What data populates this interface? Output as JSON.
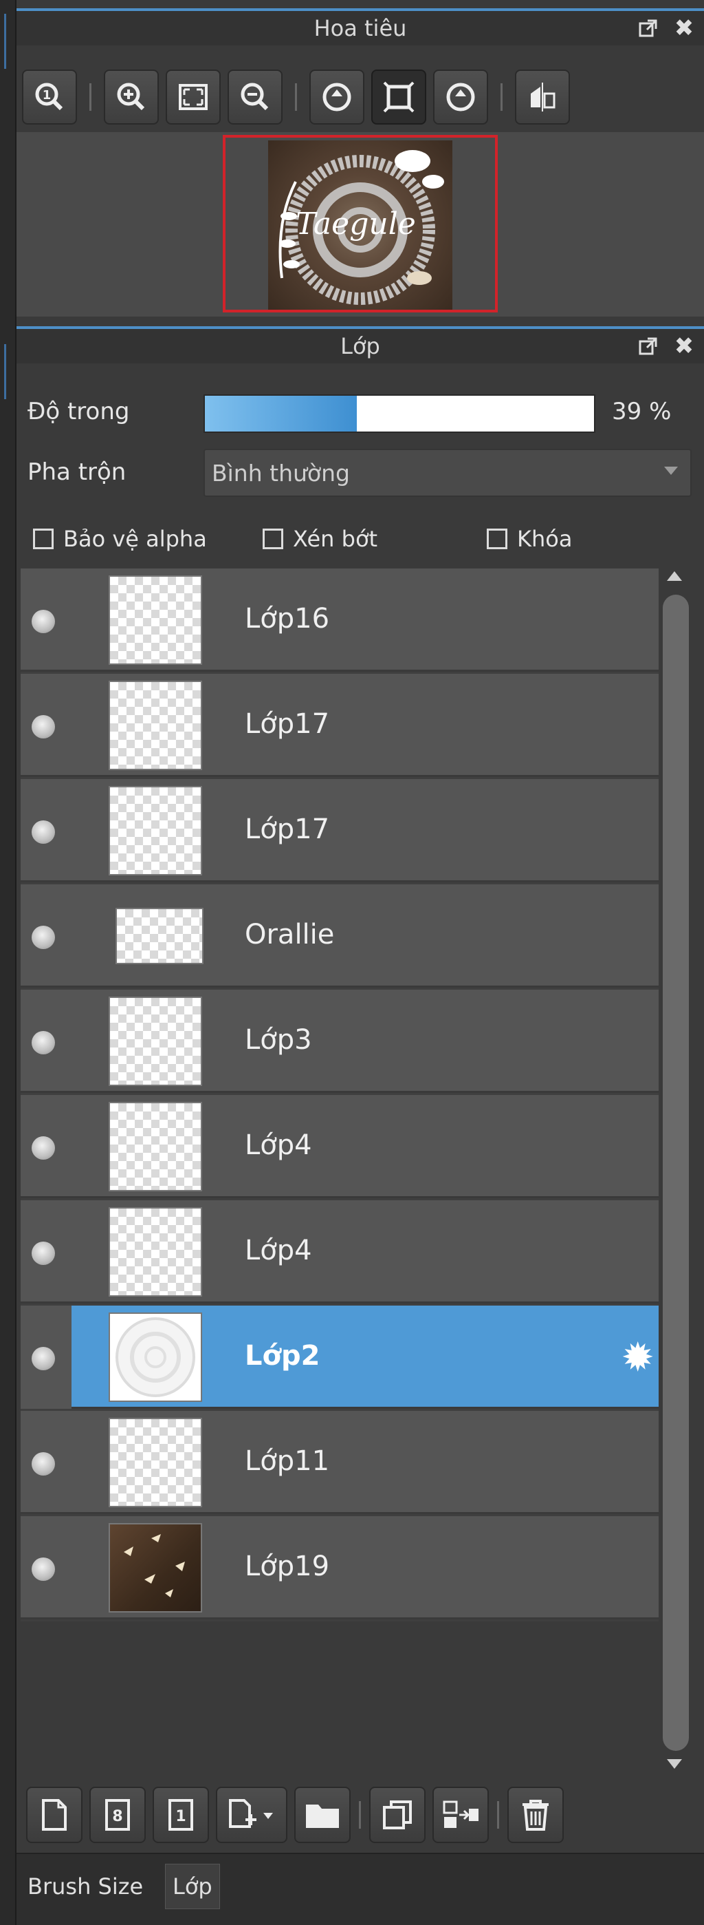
{
  "navigator": {
    "title": "Hoa tiêu",
    "tools": [
      {
        "icon": "actual-size-icon",
        "active": false
      },
      {
        "icon": "zoom-in-icon",
        "active": false
      },
      {
        "icon": "fit-screen-icon",
        "active": false
      },
      {
        "icon": "zoom-out-icon",
        "active": false
      },
      {
        "icon": "rotate-left-icon",
        "active": false
      },
      {
        "icon": "fit-window-icon",
        "active": true
      },
      {
        "icon": "rotate-right-icon",
        "active": false
      },
      {
        "icon": "flip-horizontal-icon",
        "active": false
      }
    ],
    "preview_text": "Taegule"
  },
  "layers_panel": {
    "title": "Lớp",
    "opacity_label": "Độ trong",
    "opacity_value": "39 %",
    "opacity_fraction": 0.39,
    "blend_label": "Pha trộn",
    "blend_value": "Bình thường",
    "checkboxes": {
      "protect_alpha": "Bảo vệ alpha",
      "clipping": "Xén bớt",
      "lock": "Khóa"
    },
    "layers": [
      {
        "name": "Lớp16",
        "thumb": "transparent",
        "selected": false
      },
      {
        "name": "Lớp17",
        "thumb": "transparent",
        "selected": false
      },
      {
        "name": "Lớp17",
        "thumb": "transparent",
        "selected": false
      },
      {
        "name": "Orallie",
        "thumb": "wide",
        "selected": false
      },
      {
        "name": "Lớp3",
        "thumb": "transparent",
        "selected": false
      },
      {
        "name": "Lớp4",
        "thumb": "transparent",
        "selected": false
      },
      {
        "name": "Lớp4",
        "thumb": "transparent",
        "selected": false
      },
      {
        "name": "Lớp2",
        "thumb": "circle",
        "selected": true
      },
      {
        "name": "Lớp11",
        "thumb": "transparent",
        "selected": false
      },
      {
        "name": "Lớp19",
        "thumb": "wood",
        "selected": false
      }
    ],
    "bottom_tools": [
      "new-layer-icon",
      "new-8bit-layer-icon",
      "new-1bit-layer-icon",
      "add-layer-menu-icon",
      "folder-icon",
      "duplicate-layer-icon",
      "merge-down-icon",
      "delete-layer-icon"
    ],
    "selected_color": "#4f9ad6"
  },
  "tabs": {
    "brush_size": "Brush Size",
    "layers": "Lớp"
  }
}
